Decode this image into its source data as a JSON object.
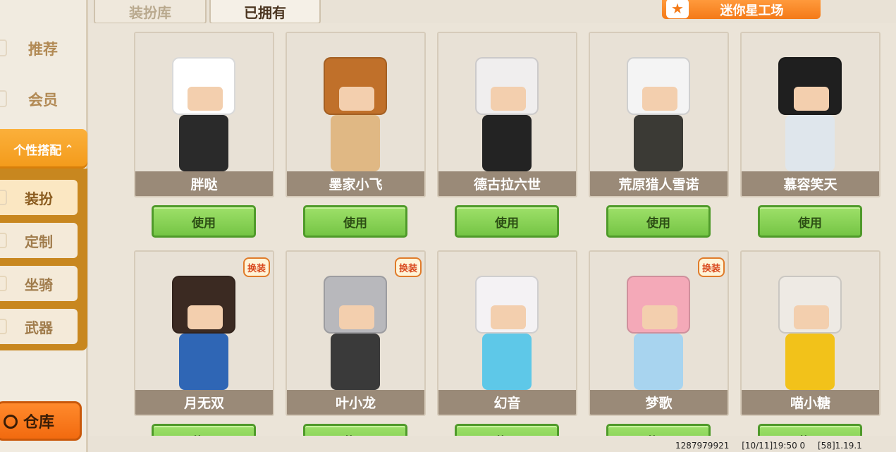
{
  "tabs": {
    "wardrobe": "装扮库",
    "owned": "已拥有"
  },
  "studio": {
    "label": "迷你星工场"
  },
  "sidebar": {
    "items": [
      {
        "label": "推荐"
      },
      {
        "label": "会员"
      }
    ],
    "group": {
      "label": "个性搭配",
      "arrow": "⌃"
    },
    "sub_items": [
      {
        "label": "装扮",
        "active": true
      },
      {
        "label": "定制"
      },
      {
        "label": "坐骑"
      },
      {
        "label": "武器"
      }
    ],
    "warehouse": "仓库"
  },
  "skins": [
    {
      "name": "胖哒",
      "button": "使用",
      "head": "#ffffff",
      "body": "#2a2a2a",
      "badge": false
    },
    {
      "name": "墨家小飞",
      "button": "使用",
      "head": "#c0702a",
      "body": "#e0b884",
      "badge": false
    },
    {
      "name": "德古拉六世",
      "button": "使用",
      "head": "#f0eeee",
      "body": "#232323",
      "badge": false
    },
    {
      "name": "荒原猎人雪诺",
      "button": "使用",
      "head": "#f4f4f4",
      "body": "#3b3a35",
      "badge": false
    },
    {
      "name": "慕容笑天",
      "button": "使用",
      "head": "#1f1f1f",
      "body": "#dfe6ec",
      "badge": false
    },
    {
      "name": "月无双",
      "button": "使用",
      "head": "#3b2a22",
      "body": "#2f66b5",
      "badge": true,
      "badge_text": "换装"
    },
    {
      "name": "叶小龙",
      "button": "使用",
      "head": "#b8b8bc",
      "body": "#3a3a3a",
      "badge": true,
      "badge_text": "换装"
    },
    {
      "name": "幻音",
      "button": "使用",
      "head": "#f4f2f4",
      "body": "#5ec8e8",
      "badge": false
    },
    {
      "name": "梦歌",
      "button": "使用",
      "head": "#f4a9b8",
      "body": "#a8d4ef",
      "badge": true,
      "badge_text": "换装"
    },
    {
      "name": "喵小糖",
      "button": "使用",
      "head": "#eeeae4",
      "body": "#f2c21a",
      "badge": false
    }
  ],
  "footer": {
    "uid": "1287979921",
    "time": "[10/11]19:50 0",
    "version": "[58]1.19.1"
  }
}
